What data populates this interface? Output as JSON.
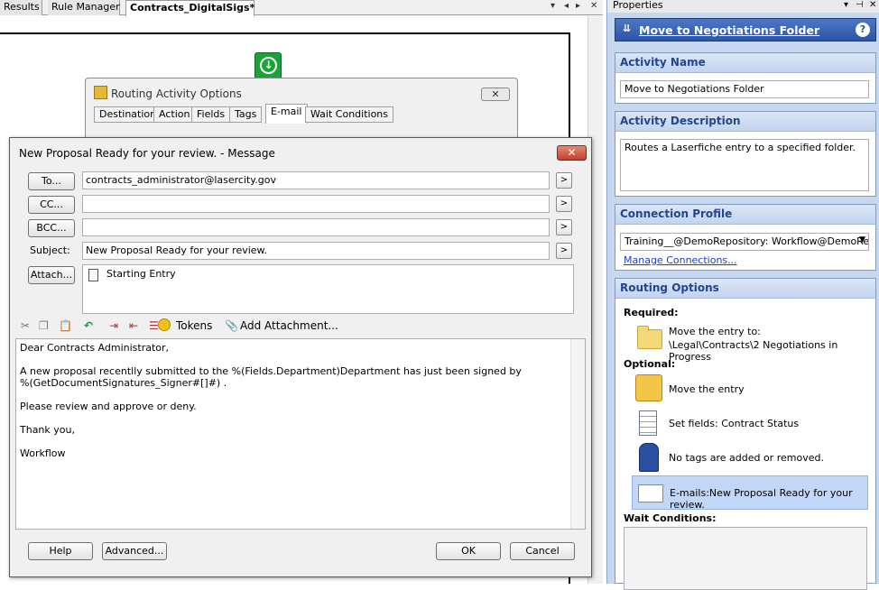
{
  "tabs": [
    "Results",
    "Rule Manager",
    "Contracts_DigitalSigs*"
  ],
  "tab_controls": [
    "▾",
    "◂",
    "▸",
    "✕"
  ],
  "routing_dialog": {
    "title": "Routing Activity Options",
    "close": "✕",
    "tabs": [
      "Destination",
      "Action",
      "Fields",
      "Tags",
      "E-mail",
      "Wait Conditions"
    ],
    "selected_tab": "E-mail"
  },
  "message": {
    "title": "New Proposal Ready for your review. - Message",
    "close": "✕",
    "to_btn": "To...",
    "cc_btn": "CC...",
    "bcc_btn": "BCC...",
    "subject_label": "Subject:",
    "to_value": "contracts_administrator@lasercity.gov",
    "cc_value": "",
    "bcc_value": "",
    "subject_value": "New Proposal Ready for your review.",
    "arrow": ">",
    "attach_btn": "Attach...",
    "attachment": "Starting Entry",
    "toolbar": {
      "tokens": "Tokens",
      "add_attachment": "Add Attachment..."
    },
    "body_lines": [
      "Dear Contracts Administrator,",
      "A new proposal recentlly submitted to the %(Fields.Department)Department has just been signed by",
      "%(GetDocumentSignatures_Signer#[]#) .",
      "Please review and approve or deny.",
      "Thank you,",
      "Workflow"
    ],
    "buttons": {
      "help": "Help",
      "advanced": "Advanced...",
      "ok": "OK",
      "cancel": "Cancel"
    }
  },
  "properties": {
    "header": "Properties",
    "header_controls": [
      "▾",
      "⊣",
      "✕"
    ],
    "title": "Move to Negotiations Folder",
    "help": "?",
    "activity_name_label": "Activity Name",
    "activity_name": "Move to Negotiations Folder",
    "activity_description_label": "Activity Description",
    "activity_description": "Routes a Laserfiche entry to a specified folder.",
    "connection_profile_label": "Connection Profile",
    "connection_profile": "Training__@DemoRepository: Workflow@DemoRepo",
    "manage_connections": "Manage Connections...",
    "routing_options_label": "Routing Options",
    "required_label": "Required:",
    "required_items": [
      {
        "line1": "Move the entry to:",
        "line2": "\\Legal\\Contracts\\2 Negotiations in Progress"
      }
    ],
    "optional_label": "Optional:",
    "optional_items": [
      "Move the entry",
      "Set fields: Contract Status",
      "No tags are added or removed.",
      "E-mails:New Proposal Ready for your review."
    ],
    "wait_conditions_label": "Wait Conditions:"
  }
}
